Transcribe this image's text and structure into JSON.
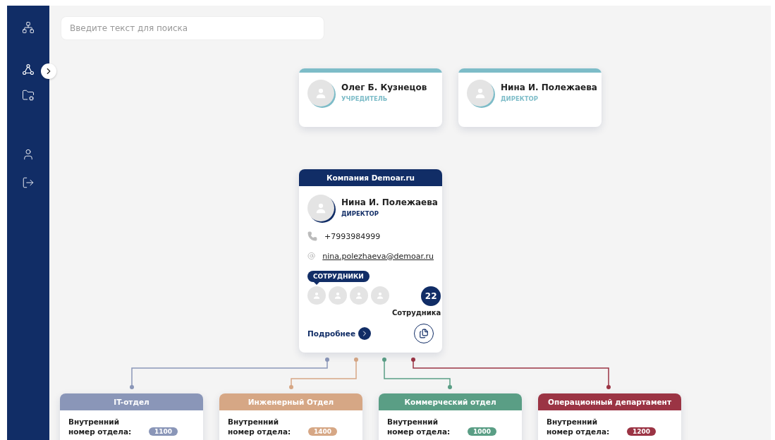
{
  "search": {
    "placeholder": "Введите текст для поиска"
  },
  "top_cards": [
    {
      "name": "Олег Б. Кузнецов",
      "role": "УЧРЕДИТЕЛЬ"
    },
    {
      "name": "Нина И. Полежаева",
      "role": "ДИРЕКТОР"
    }
  ],
  "main_card": {
    "company": "Компания Demoar.ru",
    "name": "Нина И. Полежаева",
    "role": "ДИРЕКТОР",
    "phone": "+7993984999",
    "email": "nina.polezhaeva@demoar.ru",
    "employees_label": "СОТРУДНИКИ",
    "employees_count": "22",
    "employees_caption": "Сотрудника",
    "more_link": "Подробнее"
  },
  "departments": [
    {
      "name": "IT-отдел",
      "color": "#8a96b8",
      "ext_label": "Внутренний номер отдела:",
      "number": "1100"
    },
    {
      "name": "Инженерный Отдел",
      "color": "#d6a785",
      "ext_label": "Внутренний номер отдела:",
      "number": "1400"
    },
    {
      "name": "Коммерческий отдел",
      "color": "#5a9e85",
      "ext_label": "Внутренний номер отдела:",
      "number": "1000"
    },
    {
      "name": "Операционный департамент",
      "color": "#9b3444",
      "ext_label": "Внутренний номер отдела:",
      "number": "1200"
    }
  ]
}
